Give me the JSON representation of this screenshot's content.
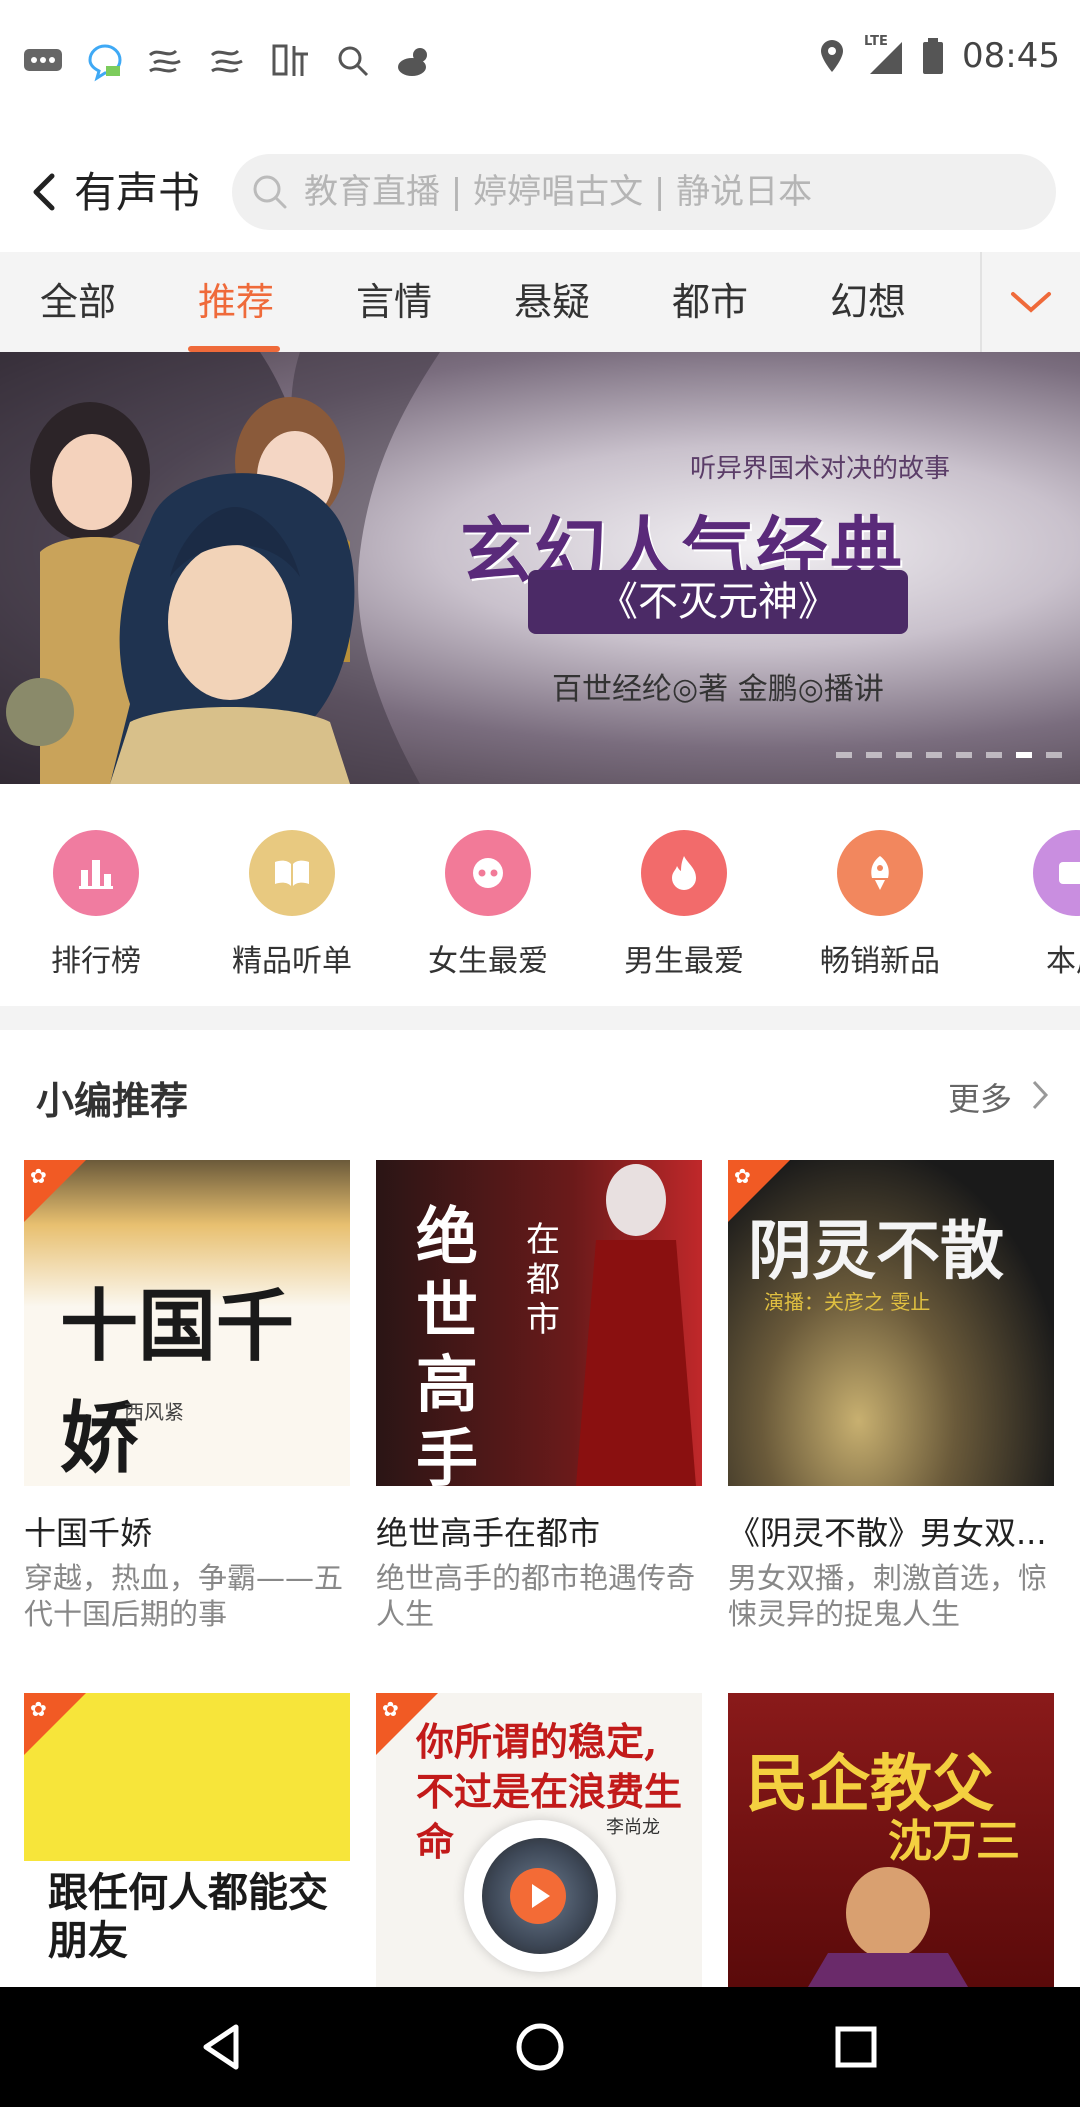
{
  "status_bar": {
    "time": "08:45",
    "network": "LTE",
    "left_icons": [
      "message-icon",
      "chat-bubble-icon",
      "swirl-icon",
      "swirl-icon",
      "ting-app-icon",
      "search-icon",
      "weather-icon"
    ],
    "right_icons": [
      "location-icon",
      "signal-icon",
      "battery-icon"
    ]
  },
  "header": {
    "title": "有声书",
    "search_placeholder": "教育直播 | 婷婷唱古文 | 静说日本"
  },
  "tabs": [
    {
      "label": "全部",
      "active": false
    },
    {
      "label": "推荐",
      "active": true
    },
    {
      "label": "言情",
      "active": false
    },
    {
      "label": "悬疑",
      "active": false
    },
    {
      "label": "都市",
      "active": false
    },
    {
      "label": "幻想",
      "active": false
    }
  ],
  "banner": {
    "tagline": "听异界国术对决的故事",
    "headline": "玄幻人气经典",
    "book_title": "《不灭元神》",
    "credit": "百世经纶◎著  金鹏◎播讲",
    "slide_count": 8,
    "active_slide": 7
  },
  "quick_entries": [
    {
      "label": "排行榜",
      "color": "#f07ca0",
      "icon": "ranking-icon"
    },
    {
      "label": "精品听单",
      "color": "#e8c980",
      "icon": "book-open-icon"
    },
    {
      "label": "女生最爱",
      "color": "#f27a98",
      "icon": "female-icon"
    },
    {
      "label": "男生最爱",
      "color": "#f26b6b",
      "icon": "flame-icon"
    },
    {
      "label": "畅销新品",
      "color": "#f2875e",
      "icon": "rocket-icon"
    },
    {
      "label": "本周",
      "color": "#c98ee0",
      "icon": "new-badge-icon"
    }
  ],
  "section": {
    "title": "小编推荐",
    "more_label": "更多"
  },
  "books": [
    {
      "title": "十国千娇",
      "desc": "穿越，热血，争霸——五代十国后期的事",
      "cover_text": "十国千娇",
      "cover_sub": "西风紧",
      "tagged": true
    },
    {
      "title": "绝世高手在都市",
      "desc": "绝世高手的都市艳遇传奇人生",
      "cover_text": "绝世高手",
      "cover_sub": "在都市",
      "tagged": false
    },
    {
      "title": "《阴灵不散》男女双...",
      "desc": "男女双播，刺激首选，惊悚灵异的捉鬼人生",
      "cover_text": "阴灵不散",
      "cover_sub": "演播：关彦之 雯止",
      "tagged": true
    },
    {
      "title": "",
      "desc": "",
      "cover_text": "跟任何人都能交朋友",
      "cover_sub": "",
      "tagged": true
    },
    {
      "title": "",
      "desc": "",
      "cover_text": "你所谓的稳定,不过是在浪费生命",
      "cover_sub": "李尚龙",
      "tagged": true
    },
    {
      "title": "",
      "desc": "",
      "cover_text": "民企教父",
      "cover_sub": "沈万三",
      "tagged": false
    }
  ],
  "nav": [
    "back-icon",
    "home-icon",
    "recents-icon"
  ]
}
